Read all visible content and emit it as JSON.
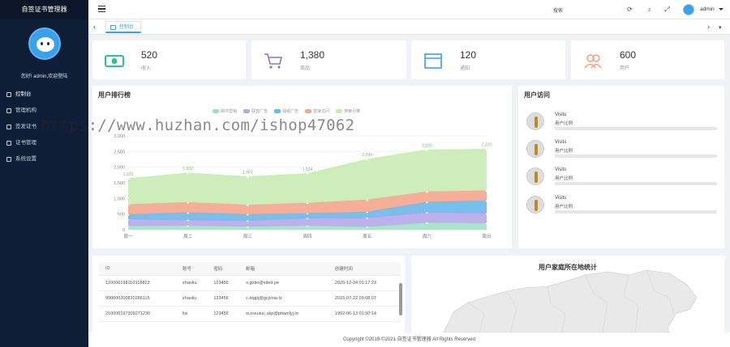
{
  "app": {
    "title": "自签证书管理器"
  },
  "sidebar": {
    "welcome": "您好! admin,欢迎登陆",
    "items": [
      {
        "label": "控制台",
        "icon": "dashboard-icon"
      },
      {
        "label": "管理机构",
        "icon": "org-icon"
      },
      {
        "label": "签发证书",
        "icon": "certificate-icon"
      },
      {
        "label": "证书管理",
        "icon": "manage-icon"
      },
      {
        "label": "系统设置",
        "icon": "settings-icon"
      }
    ]
  },
  "topbar": {
    "search_label": "搜索",
    "user_name": "admin"
  },
  "tabs": {
    "active_label": "控制台"
  },
  "stats": [
    {
      "value": "520",
      "label": "收入",
      "icon": "money-icon",
      "color": "#2fc28d"
    },
    {
      "value": "1,380",
      "label": "商品",
      "icon": "cart-icon",
      "color": "#8a76c9"
    },
    {
      "value": "120",
      "label": "通知",
      "icon": "window-icon",
      "color": "#3aa0e8"
    },
    {
      "value": "600",
      "label": "用户",
      "icon": "users-icon",
      "color": "#f2a180"
    }
  ],
  "ranking_panel": {
    "title": "用户排行榜"
  },
  "visits_panel": {
    "title": "用户访问",
    "items": [
      {
        "title": "Visits",
        "sub": "用户比例"
      },
      {
        "title": "Visits",
        "sub": "用户比例"
      },
      {
        "title": "Visits",
        "sub": "用户比例"
      },
      {
        "title": "Visits",
        "sub": "用户比例"
      }
    ]
  },
  "table": {
    "headers": [
      "ID",
      "账号",
      "密码",
      "邮箱",
      "创建时间"
    ],
    "rows": [
      [
        "120000198110318823",
        "zhaoliu",
        "123456",
        "s.gbtio@sited.pe",
        "2020-12-24 01:17:23"
      ],
      [
        "990000200810286115",
        "zhaoliu",
        "123456",
        "c.btgpj@gcjvnia.tz",
        "2015-07-22 09:08:07"
      ],
      [
        "210000197309271230",
        "lisi",
        "123456",
        "w.xseuiuc.ukp@pttamlyj.to",
        "1992-06-13 01:50:14"
      ]
    ]
  },
  "map_panel": {
    "title": "用户家庭所在地统计"
  },
  "footer": {
    "text": "Copyright ©2018-©2021 自签证书管理器 All Rights Reserved"
  },
  "watermark": {
    "text": "https://www.huzhan.com/ishop47062"
  },
  "chart_data": {
    "type": "area",
    "categories": [
      "周一",
      "周二",
      "周三",
      "周四",
      "周五",
      "周六",
      "周日"
    ],
    "ylim": [
      0,
      3000
    ],
    "yticks": [
      "0",
      "500",
      "1,000",
      "1,500",
      "2,000",
      "2,500",
      "3,000"
    ],
    "legend": [
      "邮件营销",
      "联盟广告",
      "视频广告",
      "直接访问",
      "搜索引擎"
    ],
    "top_labels": [
      "1,320",
      "1,932",
      "1,901",
      "1,934",
      "2,290",
      "2,330",
      "2,320"
    ],
    "series": [
      {
        "name": "邮件营销",
        "color": "#9ee2c4",
        "values": [
          120,
          132,
          101,
          134,
          90,
          230,
          210
        ]
      },
      {
        "name": "联盟广告",
        "color": "#b7a7ea",
        "values": [
          220,
          182,
          191,
          234,
          290,
          330,
          310
        ]
      },
      {
        "name": "视频广告",
        "color": "#6cb8ea",
        "values": [
          150,
          232,
          201,
          154,
          190,
          330,
          410
        ]
      },
      {
        "name": "直接访问",
        "color": "#f4a68e",
        "values": [
          320,
          332,
          301,
          334,
          390,
          330,
          320
        ]
      },
      {
        "name": "搜索引擎",
        "color": "#c8ebb4",
        "values": [
          820,
          932,
          901,
          934,
          1290,
          1330,
          1320
        ]
      }
    ]
  }
}
